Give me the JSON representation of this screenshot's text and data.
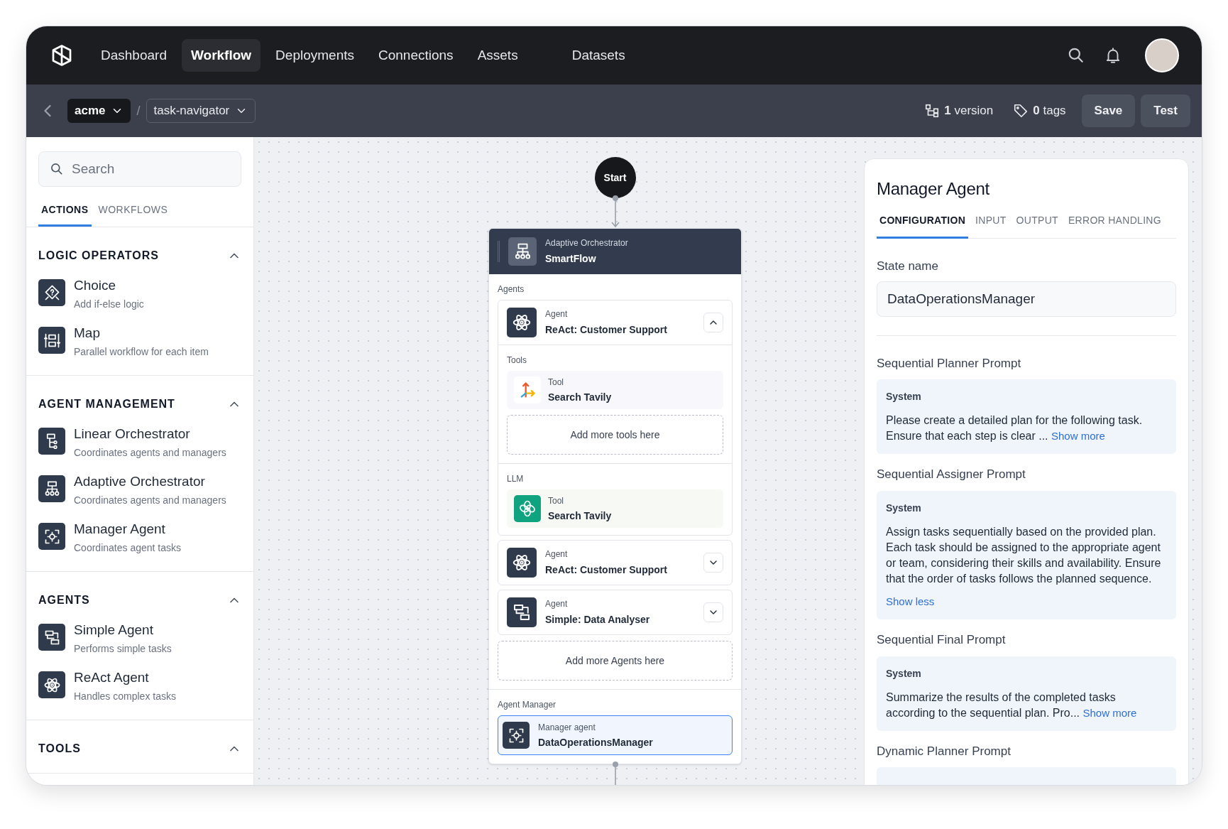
{
  "nav": {
    "items": [
      {
        "label": "Dashboard",
        "selected": false
      },
      {
        "label": "Workflow",
        "selected": true
      },
      {
        "label": "Deployments",
        "selected": false
      },
      {
        "label": "Connections",
        "selected": false
      },
      {
        "label": "Assets",
        "selected": false
      },
      {
        "label": "Datasets",
        "selected": false
      }
    ]
  },
  "toolbar": {
    "org": "acme",
    "project": "task-navigator",
    "separator": "/",
    "versions": "**1** version",
    "tags": "**0** tags",
    "buttons": [
      "Save",
      "Test"
    ]
  },
  "sidebar": {
    "search": {
      "placeholder": "Search"
    },
    "tabs": [
      {
        "label": "ACTIONS",
        "selected": true
      },
      {
        "label": "WORKFLOWS",
        "selected": false
      }
    ],
    "sections": [
      {
        "title": "LOGIC OPERATORS",
        "expanded": true,
        "items": [
          {
            "kind": "choice",
            "title": "Choice",
            "subtitle": "Add if-else logic"
          },
          {
            "kind": "map",
            "title": "Map",
            "subtitle": "Parallel workflow for each item"
          }
        ]
      },
      {
        "title": "AGENT MANAGEMENT",
        "expanded": true,
        "items": [
          {
            "kind": "linear",
            "title": "Linear Orchestrator",
            "subtitle": "Coordinates agents and managers"
          },
          {
            "kind": "adaptive",
            "title": "Adaptive Orchestrator",
            "subtitle": "Coordinates agents and managers"
          },
          {
            "kind": "manager",
            "title": "Manager Agent",
            "subtitle": "Coordinates agent tasks"
          }
        ]
      },
      {
        "title": "AGENTS",
        "expanded": true,
        "items": [
          {
            "kind": "simple",
            "title": "Simple Agent",
            "subtitle": "Performs simple tasks"
          },
          {
            "kind": "react",
            "title": "ReAct Agent",
            "subtitle": "Handles complex tasks"
          }
        ]
      },
      {
        "title": "TOOLS",
        "expanded": true
      }
    ]
  },
  "canvas": {
    "start": "Start",
    "orchestrator": {
      "type_label": "Adaptive Orchestrator",
      "name": "SmartFlow",
      "agents_label": "Agents",
      "agents": [
        {
          "kind": "react",
          "type_label": "Agent",
          "name": "ReAct: Customer Support",
          "expanded": true,
          "tools_label": "Tools",
          "tools": [
            {
              "kind": "axes",
              "type_label": "Tool",
              "name": "Search Tavily"
            }
          ],
          "add_tools": "Add more tools here",
          "llm_label": "LLM",
          "llm": {
            "kind": "knot",
            "type_label": "Tool",
            "name": "Search Tavily"
          }
        },
        {
          "kind": "react",
          "type_label": "Agent",
          "name": "ReAct: Customer Support",
          "expanded": false
        },
        {
          "kind": "simple",
          "type_label": "Agent",
          "name": "Simple: Data Analyser",
          "expanded": false
        }
      ],
      "add_agents": "Add more Agents here",
      "manager_label": "Agent Manager",
      "manager": {
        "type_label": "Manager agent",
        "name": "DataOperationsManager",
        "selected": true
      }
    }
  },
  "panel": {
    "title": "Manager Agent",
    "tabs": [
      {
        "label": "CONFIGURATION",
        "selected": true
      },
      {
        "label": "INPUT",
        "selected": false
      },
      {
        "label": "OUTPUT",
        "selected": false
      },
      {
        "label": "ERROR HANDLING",
        "selected": false
      }
    ],
    "state_name_label": "State name",
    "state_name": "DataOperationsManager",
    "prompts": [
      {
        "title": "Sequential Planner Prompt",
        "role": "System",
        "text": "Please create a detailed plan for the following task. Ensure that each step is clear ...",
        "toggle": "Show more",
        "expanded": false
      },
      {
        "title": "Sequential Assigner Prompt",
        "role": "System",
        "text": "Assign tasks sequentially based on the provided plan. Each task should be assigned to the appropriate agent or team, considering their skills and availability. Ensure that the order of tasks follows the planned sequence.",
        "toggle": "Show less",
        "expanded": true
      },
      {
        "title": "Sequential Final Prompt",
        "role": "System",
        "text": "Summarize the results of the completed tasks according to the sequential plan. Pro...",
        "toggle": "Show more",
        "expanded": false
      },
      {
        "title": "Dynamic Planner Prompt"
      }
    ]
  }
}
